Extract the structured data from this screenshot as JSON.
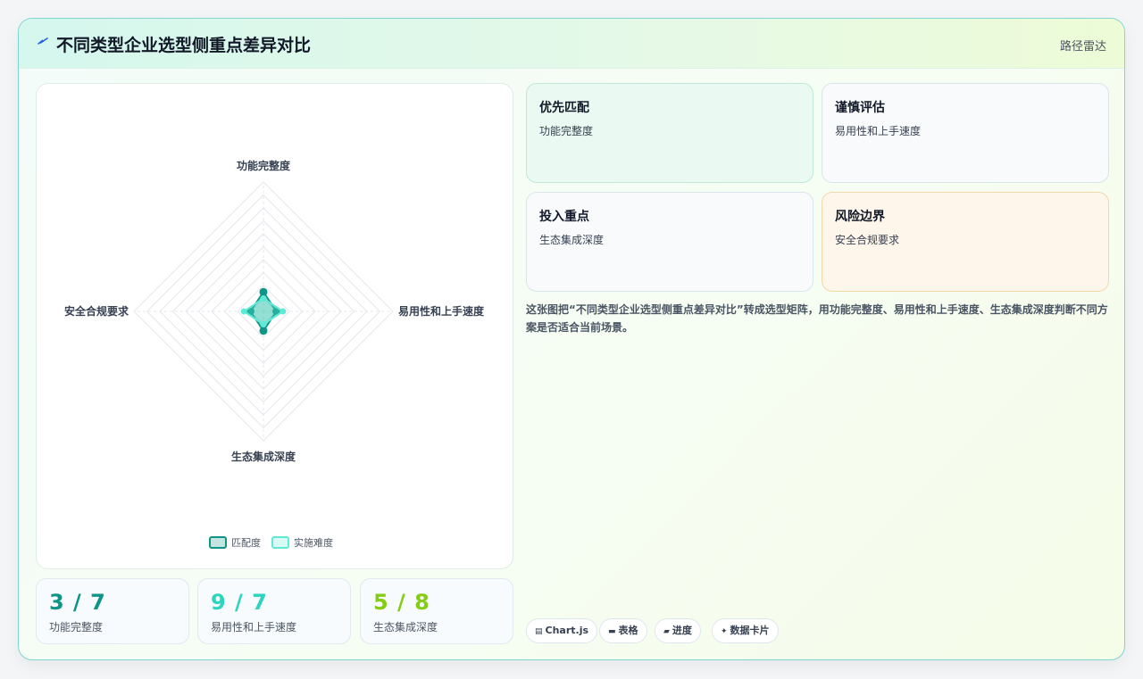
{
  "header": {
    "title": "不同类型企业选型侧重点差异对比",
    "link": "路径雷达"
  },
  "chart_data": {
    "type": "radar",
    "axes": [
      "功能完整度",
      "易用性和上手速度",
      "生态集成深度",
      "安全合规要求"
    ],
    "series": [
      {
        "name": "匹配度",
        "values": [
          3,
          2,
          3,
          2
        ],
        "color": "#0f9488"
      },
      {
        "name": "实施难度",
        "values": [
          2,
          3,
          2,
          3
        ],
        "color": "#5eead4"
      }
    ],
    "rmax": 20,
    "legend_position": "bottom",
    "grid": true
  },
  "stats": [
    {
      "value": "3 / 7",
      "label": "功能完整度",
      "color": "#0f9488"
    },
    {
      "value": "9 / 7",
      "label": "易用性和上手速度",
      "color": "#2dd4bf"
    },
    {
      "value": "5 / 8",
      "label": "生态集成深度",
      "color": "#84cc16"
    }
  ],
  "boxes": [
    {
      "title": "优先匹配",
      "text": "功能完整度"
    },
    {
      "title": "谨慎评估",
      "text": "易用性和上手速度"
    },
    {
      "title": "投入重点",
      "text": "生态集成深度"
    },
    {
      "title": "风险边界",
      "text": "安全合规要求"
    }
  ],
  "description": "这张图把“不同类型企业选型侧重点差异对比”转成选型矩阵，用功能完整度、易用性和上手速度、生态集成深度判断不同方案是否适合当前场景。",
  "tags": [
    {
      "icon": "▤",
      "label": "Chart.js"
    },
    {
      "icon": "▬",
      "label": "表格"
    },
    {
      "icon": "▰",
      "label": "进度"
    },
    {
      "icon": "✦",
      "label": "数据卡片"
    }
  ]
}
